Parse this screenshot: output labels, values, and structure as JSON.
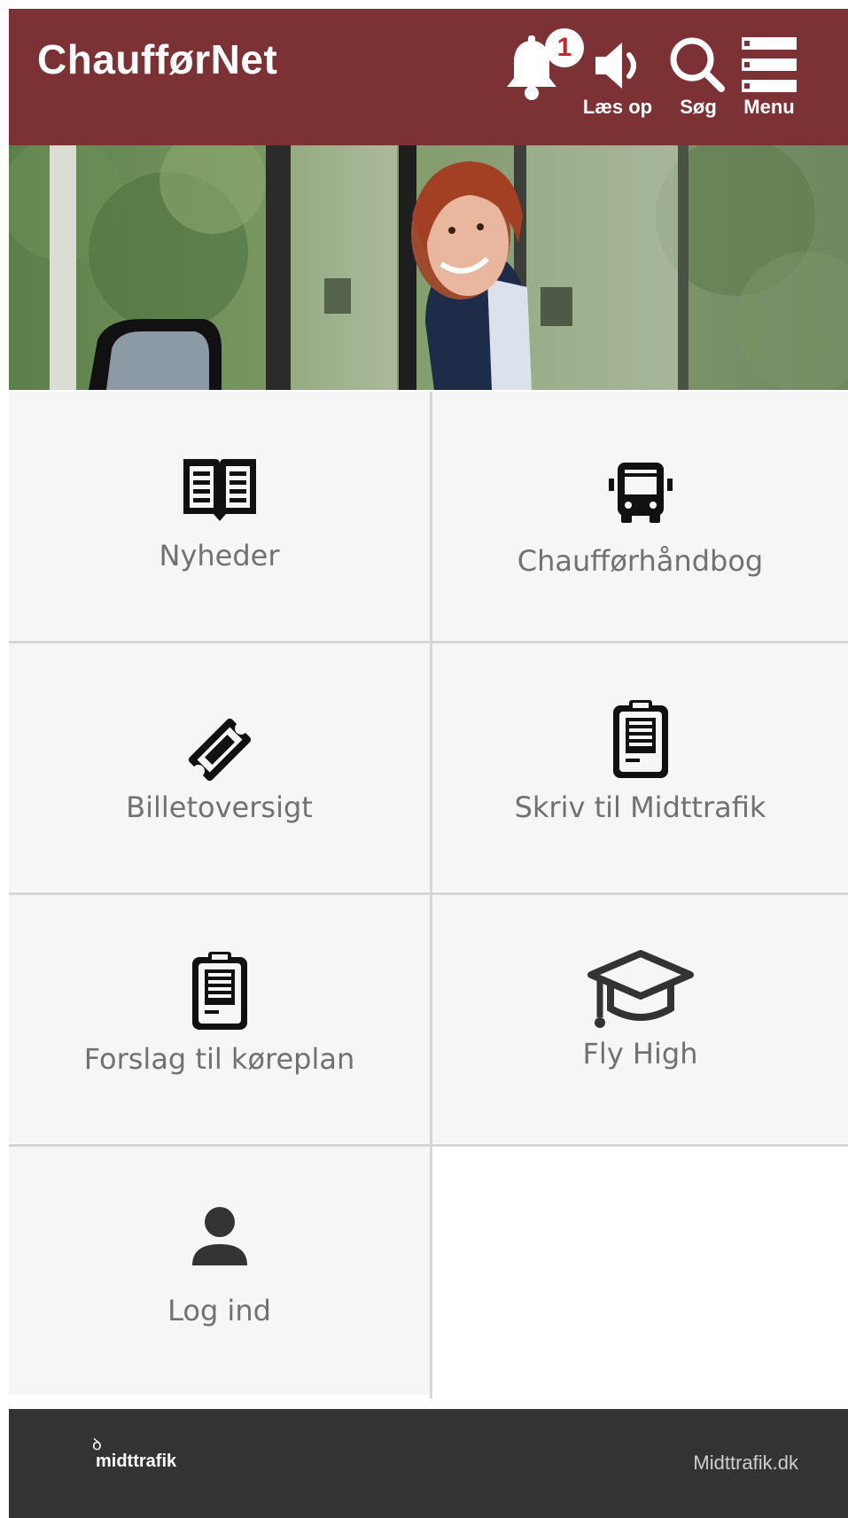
{
  "header": {
    "title": "ChaufførNet",
    "notification_count": "1",
    "read_aloud_label": "Læs op",
    "search_label": "Søg",
    "menu_label": "Menu"
  },
  "tiles": [
    {
      "label": "Nyheder",
      "icon": "open-book-icon"
    },
    {
      "label": "Chaufførhåndbog",
      "icon": "bus-icon"
    },
    {
      "label": "Billetoversigt",
      "icon": "ticket-icon"
    },
    {
      "label": "Skriv til Midttrafik",
      "icon": "clipboard-icon"
    },
    {
      "label": "Forslag til køreplan",
      "icon": "clipboard-icon"
    },
    {
      "label": "Fly High",
      "icon": "graduation-cap-icon"
    },
    {
      "label": "Log ind",
      "icon": "user-icon"
    }
  ],
  "footer": {
    "logo_text": "midttrafik",
    "link": "Midttrafik.dk"
  },
  "colors": {
    "header_bg": "#7c3134",
    "tile_bg": "#f6f6f6",
    "tile_label": "#717171",
    "footer_bg": "#333333",
    "badge_text": "#c8242b"
  }
}
